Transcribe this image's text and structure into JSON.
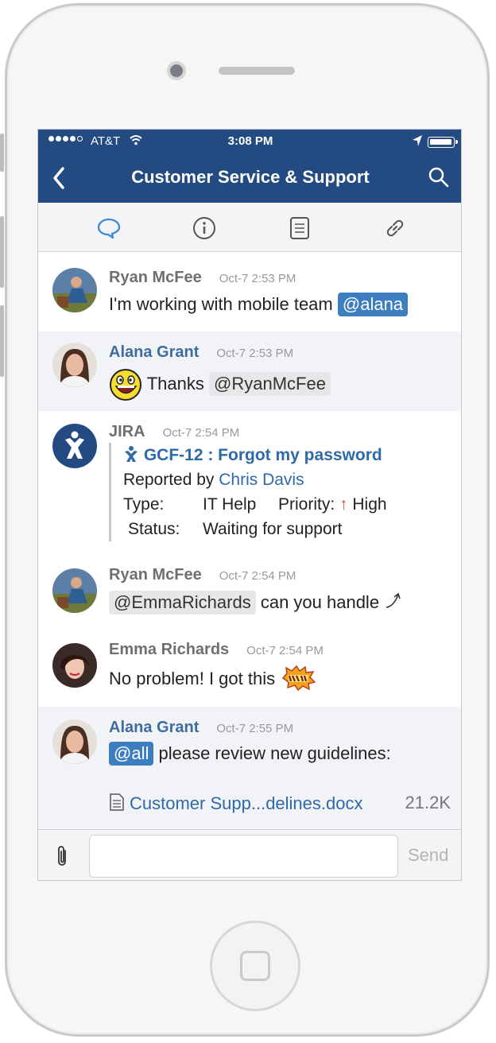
{
  "status_bar": {
    "carrier": "AT&T",
    "time": "3:08 PM"
  },
  "header": {
    "title": "Customer Service & Support"
  },
  "messages": [
    {
      "sender": "Ryan McFee",
      "time": "Oct-7 2:53 PM",
      "text": "I'm working with mobile team",
      "mention": "@alana"
    },
    {
      "sender": "Alana Grant",
      "time": "Oct-7 2:53 PM",
      "text": "Thanks",
      "mention": "@RyanMcFee"
    },
    {
      "sender": "JIRA",
      "time": "Oct-7 2:54 PM",
      "issue": "GCF-12 : Forgot my password",
      "reported_prefix": "Reported by",
      "reporter": "Chris Davis",
      "type_label": "Type:",
      "type_value": "IT Help",
      "priority_label": "Priority:",
      "priority_value": "High",
      "status_label": "Status:",
      "status_value": "Waiting for support"
    },
    {
      "sender": "Ryan McFee",
      "time": "Oct-7 2:54 PM",
      "mention": "@EmmaRichards",
      "text": "can you handle"
    },
    {
      "sender": "Emma Richards",
      "time": "Oct-7 2:54 PM",
      "text": "No problem! I got this"
    },
    {
      "sender": "Alana Grant",
      "time": "Oct-7 2:55 PM",
      "mention": "@all",
      "text": "please review new guidelines:",
      "file_name": "Customer Supp...delines.docx",
      "file_size": "21.2K"
    }
  ],
  "composer": {
    "placeholder": "",
    "send_label": "Send"
  },
  "colors": {
    "header": "#234b82",
    "link": "#2d6aa8",
    "mention_highlight": "#3d7ec1"
  }
}
